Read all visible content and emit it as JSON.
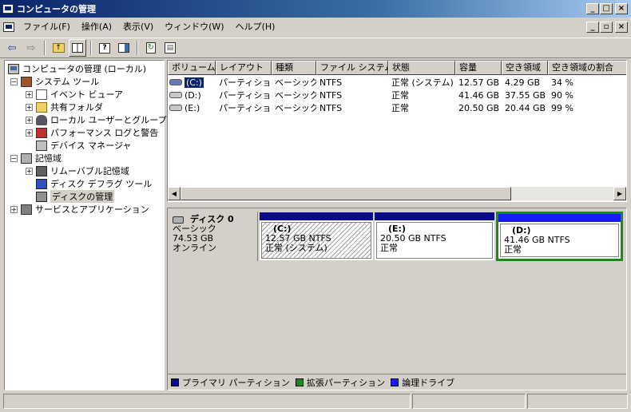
{
  "window": {
    "title": "コンピュータの管理"
  },
  "menu": {
    "items": [
      "ファイル(F)",
      "操作(A)",
      "表示(V)",
      "ウィンドウ(W)",
      "ヘルプ(H)"
    ]
  },
  "toolbar": {
    "icons": [
      "back-arrow-icon",
      "forward-arrow-icon",
      "up-folder-icon",
      "show-tree-icon",
      "properties-icon",
      "help-icon",
      "refresh-icon",
      "export-icon"
    ]
  },
  "tree": {
    "root": "コンピュータの管理 (ローカル)",
    "system_tools": "システム ツール",
    "event_viewer": "イベント ビューア",
    "shared_folders": "共有フォルダ",
    "local_users": "ローカル ユーザーとグループ",
    "perf_logs": "パフォーマンス ログと警告",
    "device_manager": "デバイス マネージャ",
    "storage": "記憶域",
    "removable": "リムーバブル記憶域",
    "defrag": "ディスク デフラグ ツール",
    "disk_mgmt": "ディスクの管理",
    "services": "サービスとアプリケーション"
  },
  "volumes": {
    "headers": [
      "ボリューム",
      "レイアウト",
      "種類",
      "ファイル システム",
      "状態",
      "容量",
      "空き領域",
      "空き領域の割合"
    ],
    "rows": [
      [
        "(C:)",
        "パーティション",
        "ベーシック",
        "NTFS",
        "正常 (システム)",
        "12.57 GB",
        "4.29 GB",
        "34 %"
      ],
      [
        "(D:)",
        "パーティション",
        "ベーシック",
        "NTFS",
        "正常",
        "41.46 GB",
        "37.55 GB",
        "90 %"
      ],
      [
        "(E:)",
        "パーティション",
        "ベーシック",
        "NTFS",
        "正常",
        "20.50 GB",
        "20.44 GB",
        "99 %"
      ]
    ]
  },
  "disk": {
    "name": "ディスク 0",
    "type": "ベーシック",
    "size": "74.53 GB",
    "status": "オンライン"
  },
  "partitions": [
    {
      "name": "(C:)",
      "size": "12.57 GB NTFS",
      "status": "正常 (システム)"
    },
    {
      "name": "(E:)",
      "size": "20.50 GB NTFS",
      "status": "正常"
    },
    {
      "name": "(D:)",
      "size": "41.46 GB NTFS",
      "status": "正常"
    }
  ],
  "legend": {
    "primary": "プライマリ パーティション",
    "extended": "拡張パーティション",
    "logical": "論理ドライブ",
    "primary_color": "#0a0a8a",
    "extended_color": "#1a8a1a",
    "logical_color": "#1a1aff"
  }
}
